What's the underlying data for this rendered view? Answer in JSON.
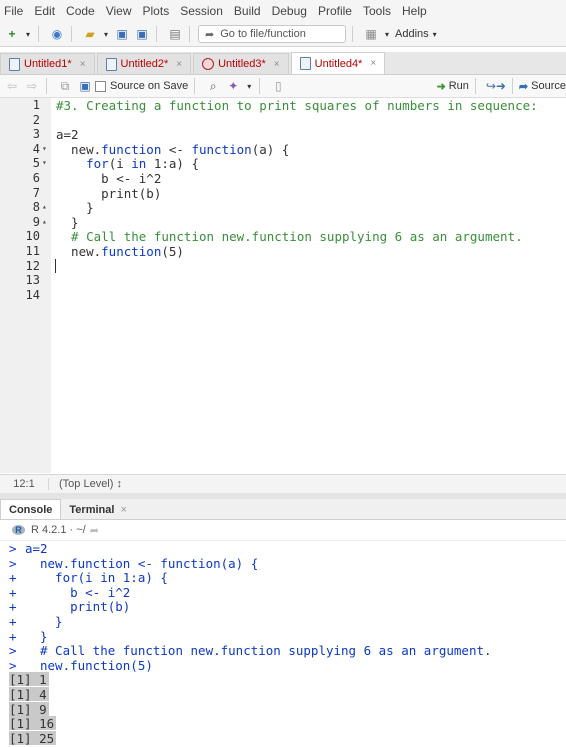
{
  "menu": [
    "File",
    "Edit",
    "Code",
    "View",
    "Plots",
    "Session",
    "Build",
    "Debug",
    "Profile",
    "Tools",
    "Help"
  ],
  "toolbar": {
    "goto_placeholder": "Go to file/function",
    "addins_label": "Addins"
  },
  "tabs": [
    {
      "label": "Untitled1*",
      "active": false
    },
    {
      "label": "Untitled2*",
      "active": false
    },
    {
      "label": "Untitled3*",
      "active": false
    },
    {
      "label": "Untitled4*",
      "active": true
    }
  ],
  "editor_toolbar": {
    "source_on_save": "Source on Save",
    "run": "Run",
    "source": "Source"
  },
  "editor": {
    "line_numbers": [
      "1",
      "2",
      "3",
      "4",
      "5",
      "6",
      "7",
      "8",
      "9",
      "10",
      "11",
      "12",
      "13",
      "14"
    ],
    "lines": [
      {
        "text": "#3. Creating a function to print squares of numbers in sequence:",
        "type": "comment"
      },
      {
        "text": "",
        "type": "code"
      },
      {
        "text": "a=2",
        "type": "code"
      },
      {
        "text": "  new.function <- function(a) {",
        "type": "code"
      },
      {
        "text": "    for(i in 1:a) {",
        "type": "code"
      },
      {
        "text": "      b <- i^2",
        "type": "code"
      },
      {
        "text": "      print(b)",
        "type": "code"
      },
      {
        "text": "    }",
        "type": "code"
      },
      {
        "text": "  }",
        "type": "code"
      },
      {
        "text": "  # Call the function new.function supplying 6 as an argument.",
        "type": "comment"
      },
      {
        "text": "  new.function(5)",
        "type": "code"
      },
      {
        "text": "",
        "type": "code"
      },
      {
        "text": "",
        "type": "code"
      },
      {
        "text": "",
        "type": "code"
      }
    ]
  },
  "status": {
    "cursor": "12:1",
    "scope": "(Top Level) ↕"
  },
  "console_tabs": [
    "Console",
    "Terminal"
  ],
  "console_header": "R 4.2.1 · ~/",
  "console": {
    "input_lines": [
      {
        "prompt": ">",
        "text": "a=2",
        "indent": false
      },
      {
        "prompt": ">",
        "text": "new.function <- function(a) {",
        "indent": true
      },
      {
        "prompt": "+",
        "text": "  for(i in 1:a) {",
        "indent": true
      },
      {
        "prompt": "+",
        "text": "    b <- i^2",
        "indent": true
      },
      {
        "prompt": "+",
        "text": "    print(b)",
        "indent": true
      },
      {
        "prompt": "+",
        "text": "  }",
        "indent": true
      },
      {
        "prompt": "+",
        "text": "}",
        "indent": true
      },
      {
        "prompt": ">",
        "text": "# Call the function new.function supplying 6 as an argument.",
        "indent": true
      },
      {
        "prompt": ">",
        "text": "new.function(5)",
        "indent": true
      }
    ],
    "output_lines": [
      "[1] 1",
      "[1] 4",
      "[1] 9",
      "[1] 16",
      "[1] 25"
    ]
  }
}
